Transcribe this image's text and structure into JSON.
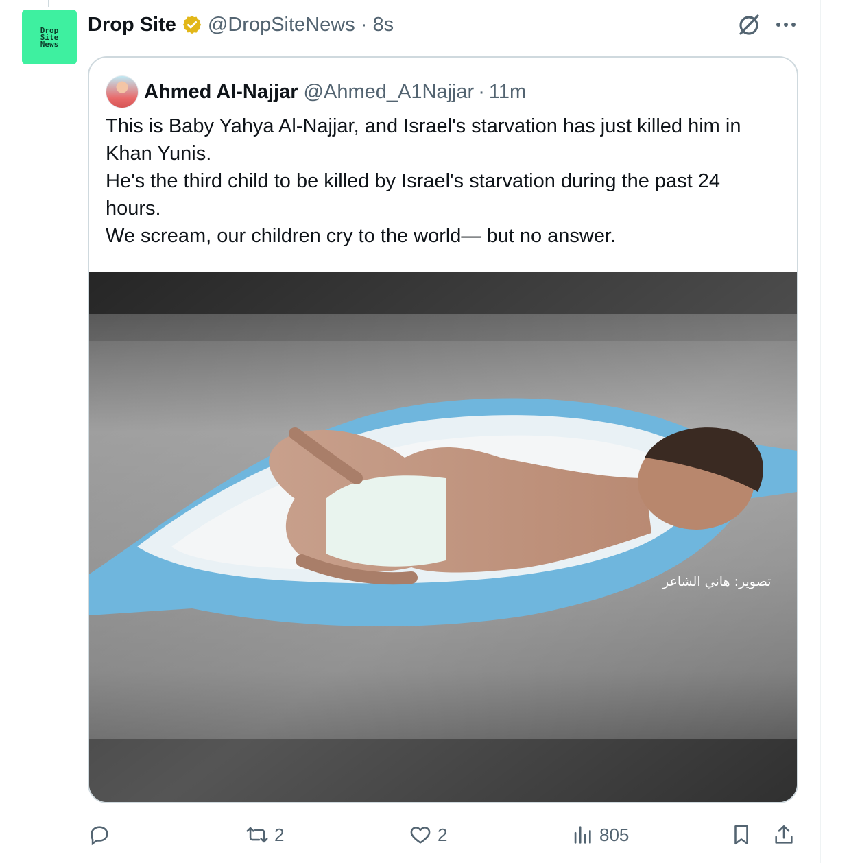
{
  "post": {
    "author_name": "Drop Site",
    "author_handle": "@DropSiteNews",
    "time": "8s",
    "avatar_logo_lines": [
      "Drop",
      "Site",
      "News"
    ]
  },
  "quoted_post": {
    "author_name": "Ahmed Al-Najjar",
    "author_handle": "@Ahmed_A1Najjar",
    "time": "11m",
    "text_lines": [
      "This is Baby Yahya Al-Najjar, and Israel's starvation has just killed him in",
      "Khan Yunis.",
      "He's the third child to be killed by Israel's starvation during the past 24",
      "hours.",
      "We scream, our children cry to the world— but no answer."
    ],
    "image_watermark": "تصوير: هاني الشاعر"
  },
  "actions": {
    "reply_count": "",
    "repost_count": "2",
    "like_count": "2",
    "views_count": "805"
  },
  "colors": {
    "brand_green": "#3ef0a0",
    "verified_gold": "#e2b719",
    "muted_text": "#536471",
    "border": "#cfd9de"
  }
}
